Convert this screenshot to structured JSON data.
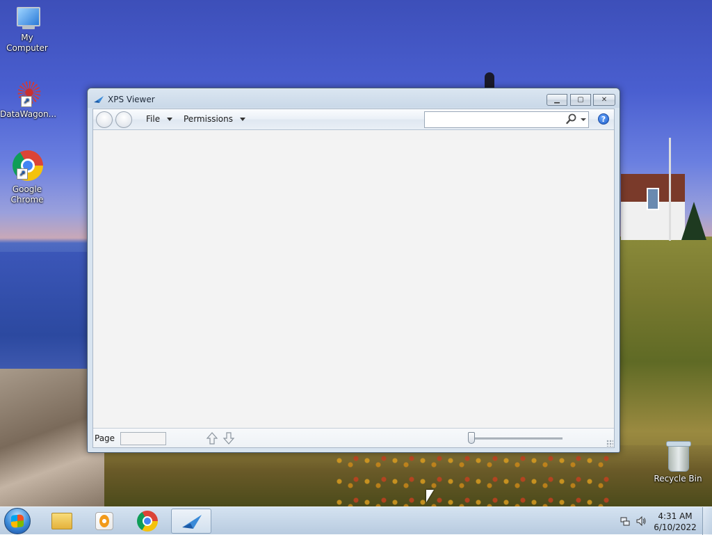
{
  "desktop": {
    "icons": [
      {
        "label": "My Computer",
        "icon": "computer-icon"
      },
      {
        "label": "DataWagon...",
        "icon": "datawagon-icon"
      },
      {
        "label": "Google Chrome",
        "icon": "chrome-icon"
      },
      {
        "label": "Recycle Bin",
        "icon": "recycle-bin-icon"
      }
    ]
  },
  "window": {
    "title": "XPS Viewer",
    "title_icon": "xps-viewer-icon",
    "caption_buttons": {
      "minimize": "minimize-icon",
      "maximize": "maximize-icon",
      "close": "close-icon"
    },
    "menus": [
      {
        "label": "File"
      },
      {
        "label": "Permissions"
      }
    ],
    "search": {
      "value": "",
      "placeholder": ""
    },
    "help_label": "?",
    "status": {
      "page_label": "Page",
      "page_value": "",
      "zoom_level": 0
    }
  },
  "taskbar": {
    "items": [
      {
        "name": "windows-explorer",
        "icon": "folder-icon"
      },
      {
        "name": "media-player",
        "icon": "media-player-icon"
      },
      {
        "name": "google-chrome",
        "icon": "chrome-icon"
      },
      {
        "name": "xps-viewer",
        "icon": "xps-viewer-icon",
        "active": true
      }
    ],
    "clock": {
      "time": "4:31 AM",
      "date": "6/10/2022"
    }
  },
  "colors": {
    "accent": "#1e5ec8",
    "window_frame": "#c9d8e8",
    "taskbar": "#c4d6ea"
  }
}
